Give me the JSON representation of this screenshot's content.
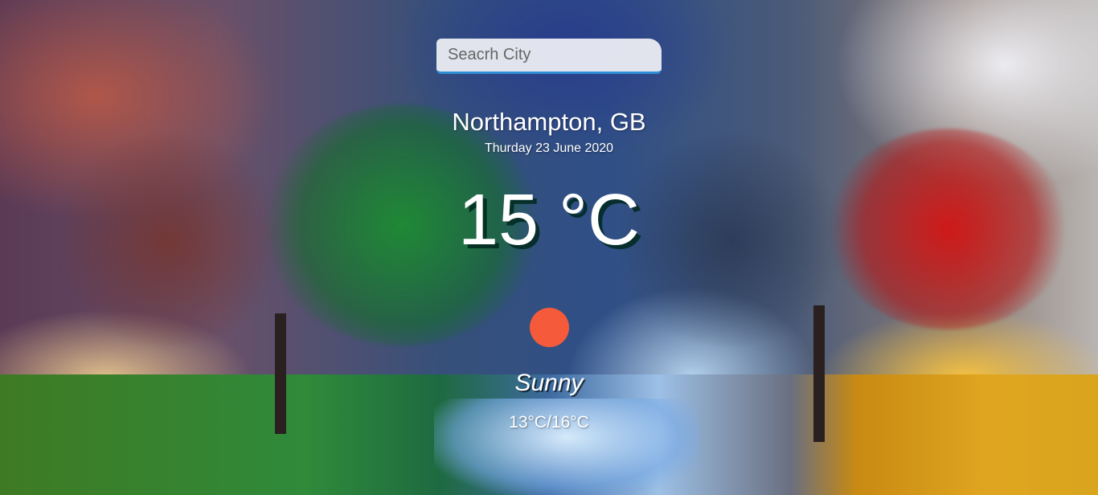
{
  "search": {
    "placeholder": "Seacrh City"
  },
  "weather": {
    "location": "Northampton, GB",
    "date": "Thurday 23 June 2020",
    "temperature": "15 °C",
    "condition": "Sunny",
    "range": "13°C/16°C",
    "icon": "sun-icon",
    "icon_color": "#f55b3a"
  },
  "colors": {
    "search_border": "#2f8fd6",
    "text": "#ffffff"
  }
}
